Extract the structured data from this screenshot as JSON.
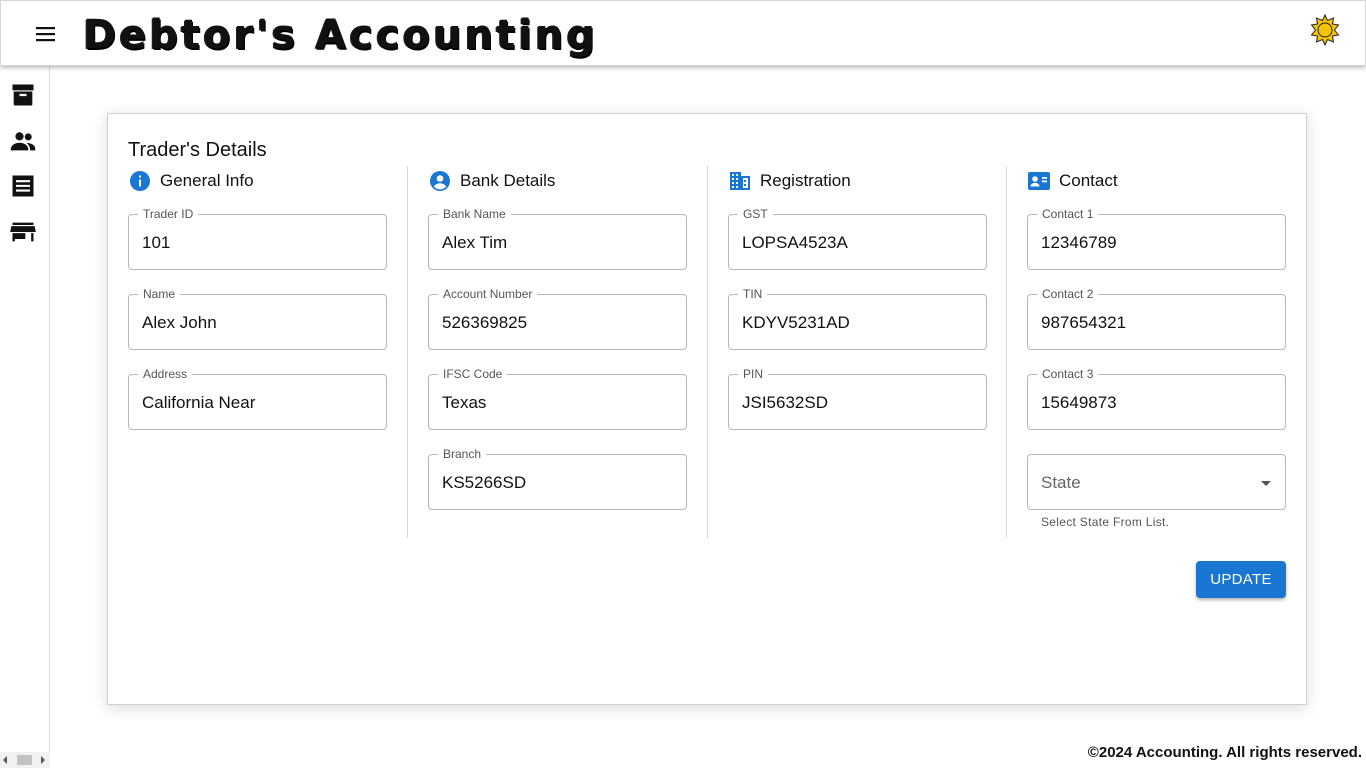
{
  "app": {
    "title": "Debtor's Accounting",
    "accent_color": "#1976d2",
    "icons": {
      "menu": "hamburger-menu-icon",
      "theme": "sun-icon"
    }
  },
  "sidebar": {
    "items": [
      {
        "icon": "archive-icon"
      },
      {
        "icon": "people-icon"
      },
      {
        "icon": "receipt-icon"
      },
      {
        "icon": "store-icon"
      }
    ]
  },
  "card": {
    "title": "Trader's Details",
    "sections": {
      "general": {
        "heading": "General Info",
        "icon": "info-icon",
        "fields": [
          {
            "label": "Trader ID",
            "value": "101"
          },
          {
            "label": "Name",
            "value": "Alex John"
          },
          {
            "label": "Address",
            "value": "California Near"
          }
        ]
      },
      "bank": {
        "heading": "Bank Details",
        "icon": "account-circle-icon",
        "fields": [
          {
            "label": "Bank Name",
            "value": "Alex Tim"
          },
          {
            "label": "Account Number",
            "value": "526369825"
          },
          {
            "label": "IFSC Code",
            "value": "Texas"
          },
          {
            "label": "Branch",
            "value": "KS5266SD"
          }
        ]
      },
      "registration": {
        "heading": "Registration",
        "icon": "building-icon",
        "fields": [
          {
            "label": "GST",
            "value": "LOPSA4523A"
          },
          {
            "label": "TIN",
            "value": "KDYV5231AD"
          },
          {
            "label": "PIN",
            "value": "JSI5632SD"
          }
        ]
      },
      "contact": {
        "heading": "Contact",
        "icon": "contact-card-icon",
        "fields": [
          {
            "label": "Contact 1",
            "value": "12346789"
          },
          {
            "label": "Contact 2",
            "value": "987654321"
          },
          {
            "label": "Contact 3",
            "value": "15649873"
          }
        ],
        "state": {
          "placeholder": "State",
          "helper": "Select State From List."
        }
      }
    },
    "update_label": "UPDATE"
  },
  "footer": {
    "text": "©2024 Accounting. All rights reserved."
  }
}
